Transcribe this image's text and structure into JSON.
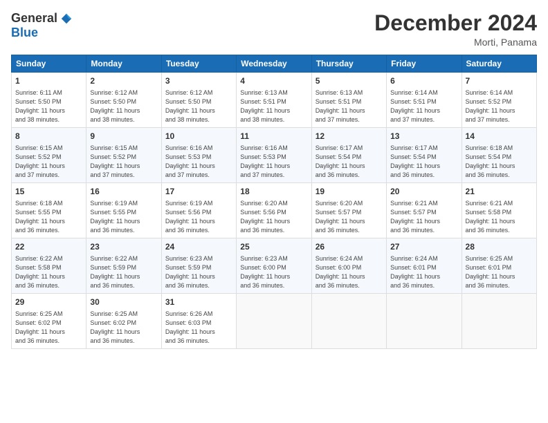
{
  "header": {
    "logo_general": "General",
    "logo_blue": "Blue",
    "month_title": "December 2024",
    "location": "Morti, Panama"
  },
  "calendar": {
    "days_of_week": [
      "Sunday",
      "Monday",
      "Tuesday",
      "Wednesday",
      "Thursday",
      "Friday",
      "Saturday"
    ],
    "weeks": [
      [
        {
          "day": "1",
          "info": "Sunrise: 6:11 AM\nSunset: 5:50 PM\nDaylight: 11 hours\nand 38 minutes."
        },
        {
          "day": "2",
          "info": "Sunrise: 6:12 AM\nSunset: 5:50 PM\nDaylight: 11 hours\nand 38 minutes."
        },
        {
          "day": "3",
          "info": "Sunrise: 6:12 AM\nSunset: 5:50 PM\nDaylight: 11 hours\nand 38 minutes."
        },
        {
          "day": "4",
          "info": "Sunrise: 6:13 AM\nSunset: 5:51 PM\nDaylight: 11 hours\nand 38 minutes."
        },
        {
          "day": "5",
          "info": "Sunrise: 6:13 AM\nSunset: 5:51 PM\nDaylight: 11 hours\nand 37 minutes."
        },
        {
          "day": "6",
          "info": "Sunrise: 6:14 AM\nSunset: 5:51 PM\nDaylight: 11 hours\nand 37 minutes."
        },
        {
          "day": "7",
          "info": "Sunrise: 6:14 AM\nSunset: 5:52 PM\nDaylight: 11 hours\nand 37 minutes."
        }
      ],
      [
        {
          "day": "8",
          "info": "Sunrise: 6:15 AM\nSunset: 5:52 PM\nDaylight: 11 hours\nand 37 minutes."
        },
        {
          "day": "9",
          "info": "Sunrise: 6:15 AM\nSunset: 5:52 PM\nDaylight: 11 hours\nand 37 minutes."
        },
        {
          "day": "10",
          "info": "Sunrise: 6:16 AM\nSunset: 5:53 PM\nDaylight: 11 hours\nand 37 minutes."
        },
        {
          "day": "11",
          "info": "Sunrise: 6:16 AM\nSunset: 5:53 PM\nDaylight: 11 hours\nand 37 minutes."
        },
        {
          "day": "12",
          "info": "Sunrise: 6:17 AM\nSunset: 5:54 PM\nDaylight: 11 hours\nand 36 minutes."
        },
        {
          "day": "13",
          "info": "Sunrise: 6:17 AM\nSunset: 5:54 PM\nDaylight: 11 hours\nand 36 minutes."
        },
        {
          "day": "14",
          "info": "Sunrise: 6:18 AM\nSunset: 5:54 PM\nDaylight: 11 hours\nand 36 minutes."
        }
      ],
      [
        {
          "day": "15",
          "info": "Sunrise: 6:18 AM\nSunset: 5:55 PM\nDaylight: 11 hours\nand 36 minutes."
        },
        {
          "day": "16",
          "info": "Sunrise: 6:19 AM\nSunset: 5:55 PM\nDaylight: 11 hours\nand 36 minutes."
        },
        {
          "day": "17",
          "info": "Sunrise: 6:19 AM\nSunset: 5:56 PM\nDaylight: 11 hours\nand 36 minutes."
        },
        {
          "day": "18",
          "info": "Sunrise: 6:20 AM\nSunset: 5:56 PM\nDaylight: 11 hours\nand 36 minutes."
        },
        {
          "day": "19",
          "info": "Sunrise: 6:20 AM\nSunset: 5:57 PM\nDaylight: 11 hours\nand 36 minutes."
        },
        {
          "day": "20",
          "info": "Sunrise: 6:21 AM\nSunset: 5:57 PM\nDaylight: 11 hours\nand 36 minutes."
        },
        {
          "day": "21",
          "info": "Sunrise: 6:21 AM\nSunset: 5:58 PM\nDaylight: 11 hours\nand 36 minutes."
        }
      ],
      [
        {
          "day": "22",
          "info": "Sunrise: 6:22 AM\nSunset: 5:58 PM\nDaylight: 11 hours\nand 36 minutes."
        },
        {
          "day": "23",
          "info": "Sunrise: 6:22 AM\nSunset: 5:59 PM\nDaylight: 11 hours\nand 36 minutes."
        },
        {
          "day": "24",
          "info": "Sunrise: 6:23 AM\nSunset: 5:59 PM\nDaylight: 11 hours\nand 36 minutes."
        },
        {
          "day": "25",
          "info": "Sunrise: 6:23 AM\nSunset: 6:00 PM\nDaylight: 11 hours\nand 36 minutes."
        },
        {
          "day": "26",
          "info": "Sunrise: 6:24 AM\nSunset: 6:00 PM\nDaylight: 11 hours\nand 36 minutes."
        },
        {
          "day": "27",
          "info": "Sunrise: 6:24 AM\nSunset: 6:01 PM\nDaylight: 11 hours\nand 36 minutes."
        },
        {
          "day": "28",
          "info": "Sunrise: 6:25 AM\nSunset: 6:01 PM\nDaylight: 11 hours\nand 36 minutes."
        }
      ],
      [
        {
          "day": "29",
          "info": "Sunrise: 6:25 AM\nSunset: 6:02 PM\nDaylight: 11 hours\nand 36 minutes."
        },
        {
          "day": "30",
          "info": "Sunrise: 6:25 AM\nSunset: 6:02 PM\nDaylight: 11 hours\nand 36 minutes."
        },
        {
          "day": "31",
          "info": "Sunrise: 6:26 AM\nSunset: 6:03 PM\nDaylight: 11 hours\nand 36 minutes."
        },
        {
          "day": "",
          "info": ""
        },
        {
          "day": "",
          "info": ""
        },
        {
          "day": "",
          "info": ""
        },
        {
          "day": "",
          "info": ""
        }
      ]
    ]
  }
}
